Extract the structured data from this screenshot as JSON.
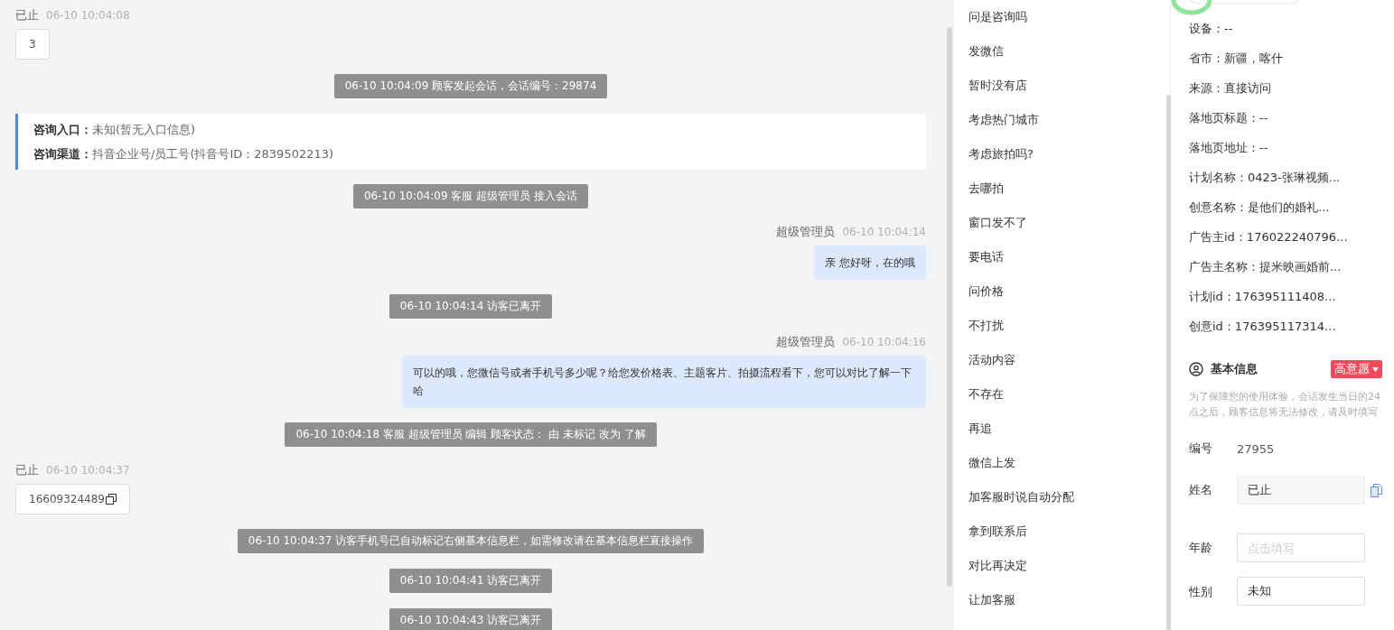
{
  "chat": {
    "messages": [
      {
        "kind": "visitor",
        "name": "已止",
        "time": "06-10 10:04:08",
        "text": "3",
        "copyable": false
      },
      {
        "kind": "system",
        "text": "06-10 10:04:09 顾客发起会话，会话编号：29874"
      },
      {
        "kind": "entry",
        "rows": [
          {
            "label": "咨询入口：",
            "value": "未知(暂无入口信息)"
          },
          {
            "label": "咨询渠道：",
            "value": "抖音企业号/员工号(抖音号ID：2839502213)"
          }
        ]
      },
      {
        "kind": "system",
        "text": "06-10 10:04:09 客服 超级管理员 接入会话"
      },
      {
        "kind": "agent",
        "name": "超级管理员",
        "time": "06-10 10:04:14",
        "text": "亲 您好呀，在的哦"
      },
      {
        "kind": "system",
        "text": "06-10 10:04:14 访客已离开"
      },
      {
        "kind": "agent",
        "name": "超级管理员",
        "time": "06-10 10:04:16",
        "text": "可以的哦，您微信号或者手机号多少呢？给您发价格表、主题客片、拍摄流程看下，您可以对比了解一下哈"
      },
      {
        "kind": "system",
        "text": "06-10 10:04:18 客服 超级管理员 编辑 顾客状态： 由 未标记 改为 了解"
      },
      {
        "kind": "visitor",
        "name": "已止",
        "time": "06-10 10:04:37",
        "text": "16609324489",
        "copyable": true
      },
      {
        "kind": "system",
        "text": "06-10 10:04:37 访客手机号已自动标记右侧基本信息栏，如需修改请在基本信息栏直接操作"
      },
      {
        "kind": "system",
        "text": "06-10 10:04:41 访客已离开"
      },
      {
        "kind": "system",
        "text": "06-10 10:04:43 访客已离开"
      }
    ]
  },
  "quick_replies": [
    "问是咨询吗",
    "发微信",
    "暂时没有店",
    "考虑热门城市",
    "考虑旅拍吗?",
    "去哪拍",
    "窗口发不了",
    "要电话",
    "问价格",
    "不打扰",
    "活动内容",
    "不存在",
    "再追",
    "微信上发",
    "加客服时说自动分配",
    "拿到联系后",
    "对比再决定",
    "让加客服"
  ],
  "visitor_info": [
    "设备：--",
    "省市：新疆，喀什",
    "来源：直接访问",
    "落地页标题：--",
    "落地页地址：--",
    "计划名称：0423-张琳视频...",
    "创意名称：是他们的婚礼...",
    "广告主id：176022240796...",
    "广告主名称：提米映画婚前...",
    "计划id：176395111408...",
    "创意id：176395117314..."
  ],
  "basic_info": {
    "title": "基本信息",
    "intent_tag": "高意愿",
    "note": "为了保障您的使用体验，会话发生当日的24点之后，顾客信息将无法修改，请及时填写",
    "fields": [
      {
        "kind": "text",
        "label": "编号",
        "value": "27955"
      },
      {
        "kind": "readonly",
        "label": "姓名",
        "value": "已止"
      },
      {
        "kind": "input",
        "label": "年龄",
        "placeholder": "点击填写"
      },
      {
        "kind": "select",
        "label": "性别",
        "value": "未知"
      }
    ]
  }
}
